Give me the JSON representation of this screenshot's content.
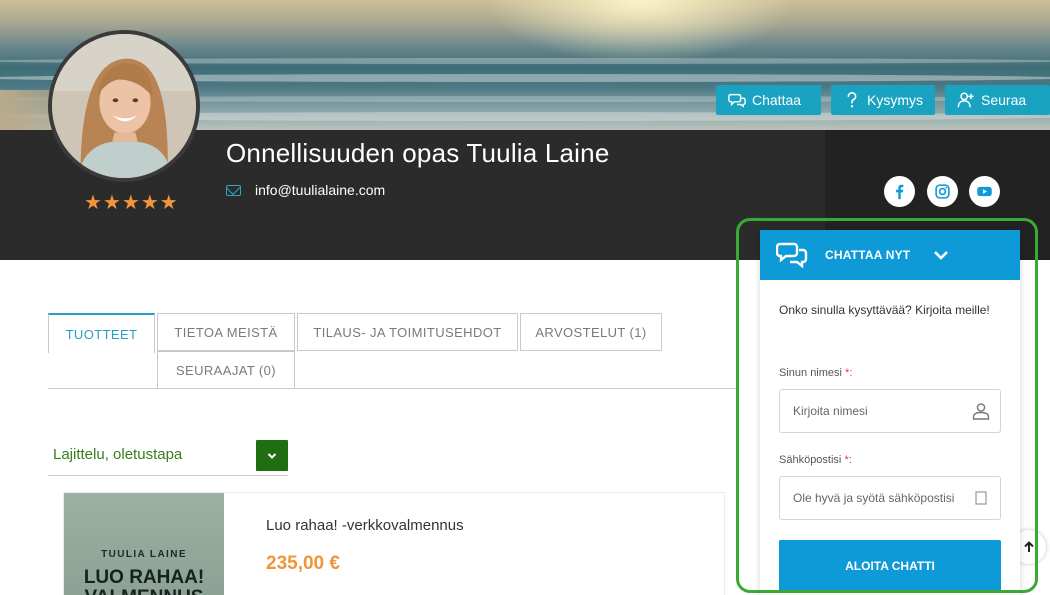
{
  "profile": {
    "name": "Onnellisuuden opas Tuulia Laine",
    "email": "info@tuulialaine.com",
    "rating_stars": 5
  },
  "actions": {
    "chat": "Chattaa",
    "question": "Kysymys",
    "follow": "Seuraa"
  },
  "social": [
    "facebook-icon",
    "instagram-icon",
    "youtube-icon"
  ],
  "tabs": [
    {
      "label": "TUOTTEET",
      "active": true
    },
    {
      "label": "TIETOA MEISTÄ"
    },
    {
      "label": "TILAUS- JA TOIMITUSEHDOT"
    },
    {
      "label": "ARVOSTELUT (1)"
    },
    {
      "label": "SEURAAJAT (0)"
    }
  ],
  "sort": {
    "selected": "Lajittelu, oletustapa"
  },
  "product": {
    "cover_author": "TUULIA LAINE",
    "cover_title": "LUO RAHAA!\nVALMENNUS",
    "name": "Luo rahaa! -verkkovalmennus",
    "price": "235,00 €"
  },
  "chat_widget": {
    "title": "CHATTAA NYT",
    "intro": "Onko sinulla kysyttävää? Kirjoita meille!",
    "name_label": "Sinun nimesi",
    "name_placeholder": "Kirjoita nimesi",
    "email_label": "Sähköpostisi",
    "email_placeholder": "Ole hyvä ja syötä sähköpostisi",
    "required_mark": "*:",
    "start_button": "ALOITA CHATTI"
  },
  "colors": {
    "accent": "#1aa3c1",
    "chat_blue": "#0d9ad6",
    "star_orange": "#f0953a",
    "sort_green": "#1f6e12",
    "highlight_green": "#3aaa35",
    "dark_band": "#2b2b2b"
  }
}
